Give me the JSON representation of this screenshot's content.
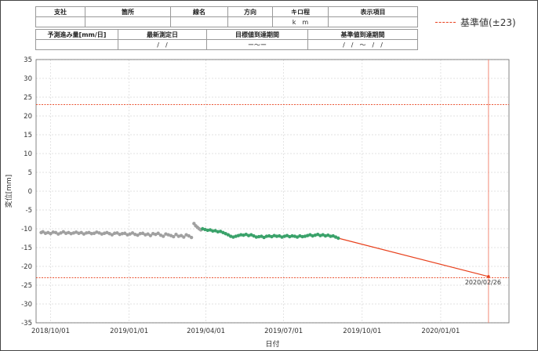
{
  "header": {
    "row1_labels": [
      "支社",
      "箇所",
      "線名",
      "方向",
      "キロ程",
      "表示項目"
    ],
    "row1_values": [
      "",
      "",
      "",
      "",
      "k　m",
      ""
    ],
    "row2_labels": [
      "予測進み量[mm/日]",
      "最新測定日",
      "目標値到達期間",
      "基準値到達期間"
    ],
    "row2_values": [
      "",
      "/　/",
      "ー～ー",
      "/　/　～　/　/"
    ]
  },
  "legend": {
    "label": "基準値(±23)",
    "color": "#e8401c"
  },
  "chart_data": {
    "type": "scatter",
    "xlabel": "日付",
    "ylabel": "変位[mm]",
    "ylim": [
      -35,
      35
    ],
    "yticks": [
      35,
      30,
      25,
      20,
      15,
      10,
      5,
      0,
      -5,
      -10,
      -15,
      -20,
      -25,
      -30,
      -35
    ],
    "xlim": [
      "2018-09-14",
      "2020-03-21"
    ],
    "xticks": [
      "2018/10/01",
      "2019/01/01",
      "2019/04/01",
      "2019/07/01",
      "2019/10/01",
      "2020/01/01"
    ],
    "threshold_lines": [
      23,
      -23
    ],
    "vertical_line": "2020-02-26",
    "series": [
      {
        "color": "#a0a0a0",
        "x": [
          "2018-09-20",
          "2018-09-22",
          "2018-09-25",
          "2018-09-28",
          "2018-10-01",
          "2018-10-04",
          "2018-10-07",
          "2018-10-10",
          "2018-10-13",
          "2018-10-16",
          "2018-10-19",
          "2018-10-22",
          "2018-10-25",
          "2018-10-28",
          "2018-10-31",
          "2018-11-03",
          "2018-11-06",
          "2018-11-09",
          "2018-11-12",
          "2018-11-15",
          "2018-11-18",
          "2018-11-21",
          "2018-11-24",
          "2018-11-27",
          "2018-11-30",
          "2018-12-03",
          "2018-12-06",
          "2018-12-09",
          "2018-12-12",
          "2018-12-15",
          "2018-12-18",
          "2018-12-21",
          "2018-12-24",
          "2018-12-27",
          "2018-12-30",
          "2019-01-02",
          "2019-01-05",
          "2019-01-08",
          "2019-01-11",
          "2019-01-14",
          "2019-01-17",
          "2019-01-20",
          "2019-01-23",
          "2019-01-26",
          "2019-01-29",
          "2019-02-01",
          "2019-02-04",
          "2019-02-07",
          "2019-02-10",
          "2019-02-13",
          "2019-02-16",
          "2019-02-19",
          "2019-02-22",
          "2019-02-25",
          "2019-02-28",
          "2019-03-03",
          "2019-03-06",
          "2019-03-09",
          "2019-03-12",
          "2019-03-15"
        ],
        "y": [
          -11,
          -10.8,
          -11.2,
          -11,
          -11.3,
          -10.9,
          -11,
          -11.4,
          -11.1,
          -10.8,
          -11.2,
          -11,
          -11.3,
          -11.1,
          -10.9,
          -11.2,
          -11,
          -11.4,
          -11.1,
          -11,
          -11.3,
          -11.2,
          -10.9,
          -11.1,
          -11.4,
          -11.2,
          -11,
          -11.3,
          -11.6,
          -11.2,
          -11.1,
          -11.5,
          -11.3,
          -11.2,
          -11.6,
          -11.4,
          -11.1,
          -11.5,
          -11.7,
          -11.3,
          -11.2,
          -11.6,
          -11.4,
          -11.8,
          -11.3,
          -11.5,
          -11.2,
          -11.7,
          -12,
          -11.4,
          -11.6,
          -11.8,
          -12.1,
          -11.5,
          -12,
          -11.8,
          -12.2,
          -11.6,
          -11.9,
          -12.3
        ]
      },
      {
        "color": "#a0a0a0",
        "x": [
          "2019-03-18",
          "2019-03-20",
          "2019-03-22",
          "2019-03-24",
          "2019-03-26"
        ],
        "y": [
          -8.6,
          -9.2,
          -9.6,
          -10,
          -10.3
        ]
      },
      {
        "color": "#3aa26a",
        "x": [
          "2019-03-28",
          "2019-03-31",
          "2019-04-03",
          "2019-04-06",
          "2019-04-09",
          "2019-04-12",
          "2019-04-15",
          "2019-04-18",
          "2019-04-21",
          "2019-04-24",
          "2019-04-27",
          "2019-04-30",
          "2019-05-03",
          "2019-05-06",
          "2019-05-09",
          "2019-05-12",
          "2019-05-15",
          "2019-05-18",
          "2019-05-21",
          "2019-05-24",
          "2019-05-27",
          "2019-05-30",
          "2019-06-02",
          "2019-06-05",
          "2019-06-08",
          "2019-06-11",
          "2019-06-14",
          "2019-06-17",
          "2019-06-20",
          "2019-06-23",
          "2019-06-26",
          "2019-06-29",
          "2019-07-02",
          "2019-07-05",
          "2019-07-08",
          "2019-07-11",
          "2019-07-14",
          "2019-07-17",
          "2019-07-20",
          "2019-07-23",
          "2019-07-26",
          "2019-07-29",
          "2019-08-01",
          "2019-08-04",
          "2019-08-07",
          "2019-08-10",
          "2019-08-13",
          "2019-08-16",
          "2019-08-19",
          "2019-08-22",
          "2019-08-25",
          "2019-08-28",
          "2019-08-31",
          "2019-09-03"
        ],
        "y": [
          -10,
          -10.2,
          -10.4,
          -10.3,
          -10.6,
          -10.5,
          -10.8,
          -10.7,
          -11,
          -11.3,
          -11.6,
          -12,
          -12.2,
          -12,
          -11.8,
          -11.6,
          -11.7,
          -11.5,
          -11.8,
          -11.6,
          -11.9,
          -12.2,
          -12.1,
          -12,
          -12.3,
          -12,
          -11.9,
          -12.1,
          -11.8,
          -12,
          -11.9,
          -12.2,
          -12,
          -11.8,
          -12.1,
          -11.9,
          -12,
          -12.2,
          -11.9,
          -12.1,
          -12,
          -11.8,
          -11.6,
          -11.9,
          -11.7,
          -11.5,
          -11.8,
          -11.6,
          -11.9,
          -11.7,
          -12,
          -11.9,
          -12.2,
          -12.5
        ]
      }
    ],
    "forecast": {
      "color": "#e8401c",
      "x": [
        "2019-09-03",
        "2020-02-26"
      ],
      "y": [
        -12.5,
        -22.7
      ]
    },
    "annotation": {
      "text": "2020/02/26",
      "x": "2020-02-26",
      "y": -22.7
    }
  }
}
